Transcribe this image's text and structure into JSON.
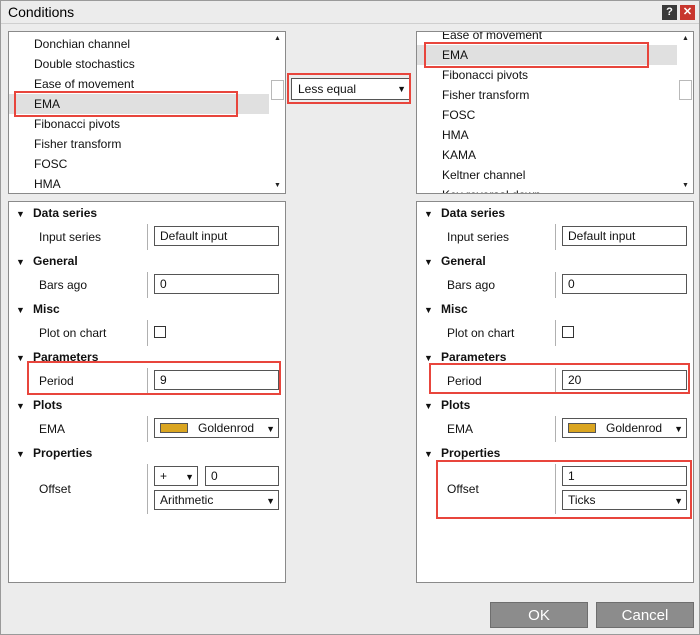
{
  "window": {
    "title": "Conditions",
    "help_label": "?",
    "close_label": "✕"
  },
  "left_list": {
    "items": [
      "Donchian channel",
      "Double stochastics",
      "Ease of movement",
      "EMA",
      "Fibonacci pivots",
      "Fisher transform",
      "FOSC",
      "HMA"
    ],
    "selected": "EMA"
  },
  "right_list": {
    "items": [
      "Ease of movement",
      "EMA",
      "Fibonacci pivots",
      "Fisher transform",
      "FOSC",
      "HMA",
      "KAMA",
      "Keltner channel",
      "Key reversal down"
    ],
    "selected": "EMA"
  },
  "operator": {
    "value": "Less equal"
  },
  "left_panel": {
    "categories": {
      "data_series": "Data series",
      "general": "General",
      "misc": "Misc",
      "parameters": "Parameters",
      "plots": "Plots",
      "properties": "Properties"
    },
    "labels": {
      "input_series": "Input series",
      "bars_ago": "Bars ago",
      "plot_on_chart": "Plot on chart",
      "period": "Period",
      "ema": "EMA",
      "offset": "Offset"
    },
    "values": {
      "input_series": "Default input",
      "bars_ago": "0",
      "plot_on_chart": false,
      "period": "9",
      "plot_color": "Goldenrod",
      "offset_sign": "+",
      "offset_value": "0",
      "offset_type": "Arithmetic"
    }
  },
  "right_panel": {
    "categories": {
      "data_series": "Data series",
      "general": "General",
      "misc": "Misc",
      "parameters": "Parameters",
      "plots": "Plots",
      "properties": "Properties"
    },
    "labels": {
      "input_series": "Input series",
      "bars_ago": "Bars ago",
      "plot_on_chart": "Plot on chart",
      "period": "Period",
      "ema": "EMA",
      "offset": "Offset"
    },
    "values": {
      "input_series": "Default input",
      "bars_ago": "0",
      "plot_on_chart": false,
      "period": "20",
      "plot_color": "Goldenrod",
      "offset_value": "1",
      "offset_type": "Ticks"
    }
  },
  "buttons": {
    "ok": "OK",
    "cancel": "Cancel"
  },
  "colors": {
    "highlight": "#e8453c",
    "goldenrod": "#daa520",
    "button": "#8c8c8c"
  }
}
